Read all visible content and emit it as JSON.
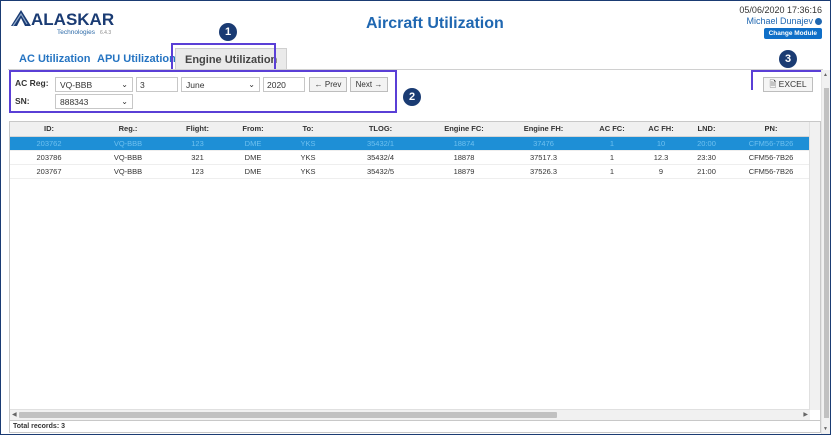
{
  "header": {
    "logo_main": "ALASKAR",
    "logo_sub": "Technologies",
    "logo_version": "6.4.3",
    "title": "Aircraft Utilization",
    "datetime": "05/06/2020 17:36:16",
    "user": "Michael Dunajev",
    "change_module": "Change Module"
  },
  "badges": [
    "1",
    "2",
    "3"
  ],
  "tabs": [
    {
      "label": "AC Utilization"
    },
    {
      "label": "APU Utilization"
    },
    {
      "label": "Engine Utilization"
    }
  ],
  "filter": {
    "ac_reg_label": "AC Reg:",
    "ac_reg_value": "VQ-BBB",
    "day_value": "3",
    "month_value": "June",
    "year_value": "2020",
    "prev_label": "← Prev",
    "next_label": "Next →",
    "sn_label": "SN:",
    "sn_value": "888343"
  },
  "excel_label": "EXCEL",
  "table": {
    "headers": [
      "ID:",
      "Reg.:",
      "Flight:",
      "From:",
      "To:",
      "TLOG:",
      "Engine FC:",
      "Engine FH:",
      "AC FC:",
      "AC FH:",
      "LND:",
      "PN:"
    ],
    "rows": [
      [
        "203762",
        "VQ-BBB",
        "123",
        "DME",
        "YKS",
        "35432/1",
        "18874",
        "37476",
        "1",
        "10",
        "20:00",
        "CFM56-7B26"
      ],
      [
        "203786",
        "VQ-BBB",
        "321",
        "DME",
        "YKS",
        "35432/4",
        "18878",
        "37517.3",
        "1",
        "12.3",
        "23:30",
        "CFM56-7B26"
      ],
      [
        "203767",
        "VQ-BBB",
        "123",
        "DME",
        "YKS",
        "35432/5",
        "18879",
        "37526.3",
        "1",
        "9",
        "21:00",
        "CFM56-7B26"
      ]
    ],
    "selected_row": 0
  },
  "footer": {
    "total_records": "Total records: 3"
  },
  "colors": {
    "accent": "#1f67b1",
    "selected_row": "#1e8fd6",
    "highlight_outline": "#5a3fd6",
    "badge": "#1a3b73"
  }
}
